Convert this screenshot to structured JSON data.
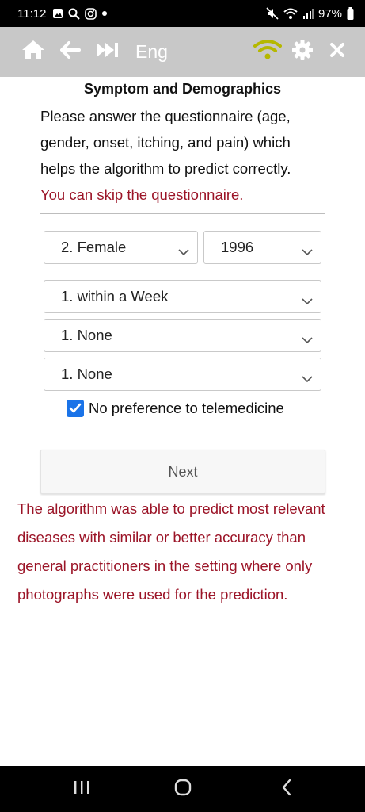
{
  "status_bar": {
    "time": "11:12",
    "battery": "97%",
    "left_icons": [
      "gallery-icon",
      "search-icon",
      "instagram-icon",
      "dot-icon"
    ],
    "right_icons": [
      "mute-icon",
      "wifi-icon",
      "signal-icon",
      "battery-icon"
    ]
  },
  "toolbar": {
    "language": "Eng",
    "icons": [
      "home-icon",
      "back-arrow-icon",
      "skip-forward-icon",
      "wifi-icon",
      "gear-icon",
      "close-icon"
    ],
    "colors": {
      "background": "#c8c8c8",
      "icon": "#ffffff",
      "wifi": "#b5b800"
    }
  },
  "form": {
    "title": "Symptom and Demographics",
    "intro": "Please answer the questionnaire (age, gender, onset, itching, and pain) which helps the algorithm to predict correctly.",
    "skip_note": "You can skip the questionnaire.",
    "gender_value": "2. Female",
    "birth_year_value": "1996",
    "onset_value": "1. within a Week",
    "itching_value": "1. None",
    "pain_value": "1. None",
    "telemedicine_label": "No preference to telemedicine",
    "telemedicine_checked": true,
    "next_label": "Next"
  },
  "disclaimer": "The algorithm was able to predict most relevant diseases with similar or better accuracy than general practitioners in the setting where only photographs were used for the prediction.",
  "colors": {
    "accent_red": "#9b1427",
    "checkbox_blue": "#1a73e8"
  },
  "nav_bar": {
    "icons": [
      "recent-apps-icon",
      "home-nav-icon",
      "back-nav-icon"
    ]
  }
}
